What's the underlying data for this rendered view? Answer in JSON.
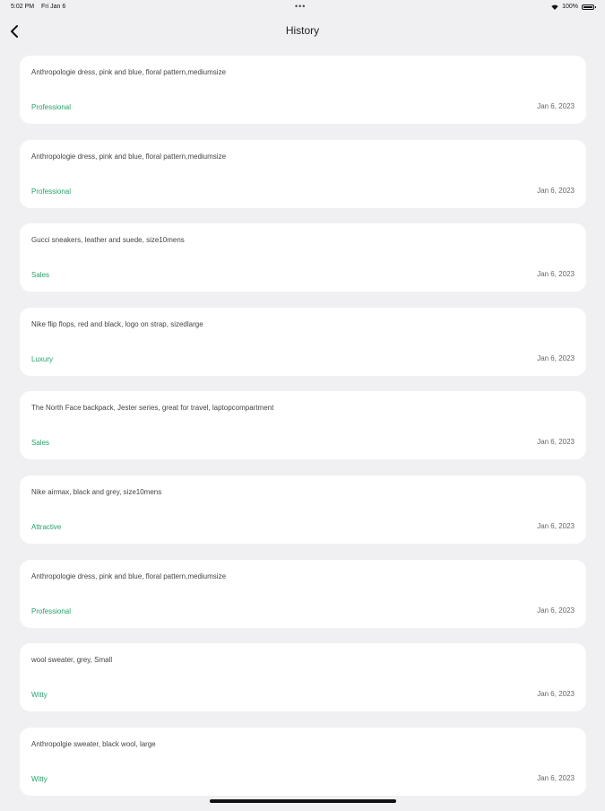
{
  "status": {
    "time": "5:02 PM",
    "date": "Fri Jan 6",
    "dots": "•••",
    "battery": "100%",
    "battery_level": 1.0
  },
  "nav": {
    "title": "History",
    "back_icon": "chevron-left-icon"
  },
  "colors": {
    "background": "#f0f0f2",
    "card": "#ffffff",
    "tag": "#25a36b"
  },
  "history": [
    {
      "text": "Anthropologie dress, pink and blue, floral pattern,mediumsize",
      "tag": "Professional",
      "date": "Jan 6, 2023"
    },
    {
      "text": "Anthropologie dress, pink and blue, floral pattern,mediumsize",
      "tag": "Professional",
      "date": "Jan 6, 2023"
    },
    {
      "text": "Gucci sneakers, leather and suede, size10mens",
      "tag": "Sales",
      "date": "Jan 6, 2023"
    },
    {
      "text": "Nike flip flops, red and black, logo on strap, sizedlarge",
      "tag": "Luxury",
      "date": "Jan 6, 2023"
    },
    {
      "text": "The North Face backpack, Jester series, great for travel, laptopcompartment",
      "tag": "Sales",
      "date": "Jan 6, 2023"
    },
    {
      "text": "Nike airmax, black and grey, size10mens",
      "tag": "Attractive",
      "date": "Jan 6, 2023"
    },
    {
      "text": "Anthropologie dress, pink and blue, floral pattern,mediumsize",
      "tag": "Professional",
      "date": "Jan 6, 2023"
    },
    {
      "text": "wool sweater, grey, Small",
      "tag": "Witty",
      "date": "Jan 6, 2023"
    },
    {
      "text": "Anthropolgie sweater, black wool,  large",
      "tag": "Witty",
      "date": "Jan 6, 2023"
    }
  ]
}
